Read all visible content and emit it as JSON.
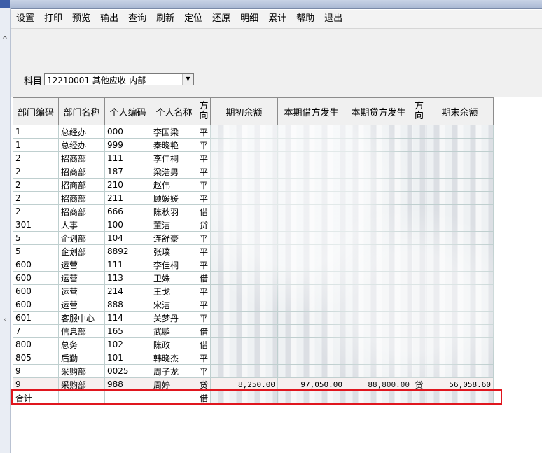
{
  "menu": {
    "items": [
      "设置",
      "打印",
      "预览",
      "输出",
      "查询",
      "刷新",
      "定位",
      "还原",
      "明细",
      "累计",
      "帮助",
      "退出"
    ]
  },
  "subject": {
    "label": "科目",
    "selected": "12210001 其他应收-内部"
  },
  "table": {
    "headers": [
      "部门编码",
      "部门名称",
      "个人编码",
      "个人名称",
      "方向",
      "期初余额",
      "本期借方发生",
      "本期贷方发生",
      "方向",
      "期末余额"
    ],
    "rows": [
      {
        "dept_code": "1",
        "dept_name": "总经办",
        "person_code": "000",
        "person_name": "李国梁",
        "dir": "平"
      },
      {
        "dept_code": "1",
        "dept_name": "总经办",
        "person_code": "999",
        "person_name": "秦晓艳",
        "dir": "平"
      },
      {
        "dept_code": "2",
        "dept_name": "招商部",
        "person_code": "111",
        "person_name": "李佳桐",
        "dir": "平"
      },
      {
        "dept_code": "2",
        "dept_name": "招商部",
        "person_code": "187",
        "person_name": "梁浩男",
        "dir": "平"
      },
      {
        "dept_code": "2",
        "dept_name": "招商部",
        "person_code": "210",
        "person_name": "赵伟",
        "dir": "平"
      },
      {
        "dept_code": "2",
        "dept_name": "招商部",
        "person_code": "211",
        "person_name": "顾媛媛",
        "dir": "平"
      },
      {
        "dept_code": "2",
        "dept_name": "招商部",
        "person_code": "666",
        "person_name": "陈秋羽",
        "dir": "借"
      },
      {
        "dept_code": "301",
        "dept_name": "人事",
        "person_code": "100",
        "person_name": "董洁",
        "dir": "贷"
      },
      {
        "dept_code": "5",
        "dept_name": "企划部",
        "person_code": "104",
        "person_name": "连舒豪",
        "dir": "平"
      },
      {
        "dept_code": "5",
        "dept_name": "企划部",
        "person_code": "8892",
        "person_name": "张璞",
        "dir": "平"
      },
      {
        "dept_code": "600",
        "dept_name": "运营",
        "person_code": "111",
        "person_name": "李佳桐",
        "dir": "平"
      },
      {
        "dept_code": "600",
        "dept_name": "运营",
        "person_code": "113",
        "person_name": "卫姝",
        "dir": "借"
      },
      {
        "dept_code": "600",
        "dept_name": "运营",
        "person_code": "214",
        "person_name": "王戈",
        "dir": "平"
      },
      {
        "dept_code": "600",
        "dept_name": "运营",
        "person_code": "888",
        "person_name": "宋洁",
        "dir": "平"
      },
      {
        "dept_code": "601",
        "dept_name": "客服中心",
        "person_code": "114",
        "person_name": "关梦丹",
        "dir": "平"
      },
      {
        "dept_code": "7",
        "dept_name": "信息部",
        "person_code": "165",
        "person_name": "武鹏",
        "dir": "借"
      },
      {
        "dept_code": "800",
        "dept_name": "总务",
        "person_code": "102",
        "person_name": "陈政",
        "dir": "借"
      },
      {
        "dept_code": "805",
        "dept_name": "后勤",
        "person_code": "101",
        "person_name": "韩晓杰",
        "dir": "平"
      },
      {
        "dept_code": "9",
        "dept_name": "采购部",
        "person_code": "0025",
        "person_name": "周子龙",
        "dir": "平"
      }
    ],
    "highlight_row": {
      "dept_code": "9",
      "dept_name": "采购部",
      "person_code": "988",
      "person_name": "周婷",
      "dir": "贷",
      "opening": "8,250.00",
      "debit": "97,050.00",
      "credit": "88,800.00",
      "end_dir": "贷",
      "closing": "56,058.60"
    },
    "total_row": {
      "label": "合计",
      "dir": "借"
    }
  },
  "colors": {
    "highlight_border": "#e0161e",
    "menu_bg": "#f3f3f3",
    "header_bg": "#f0f0f0"
  }
}
